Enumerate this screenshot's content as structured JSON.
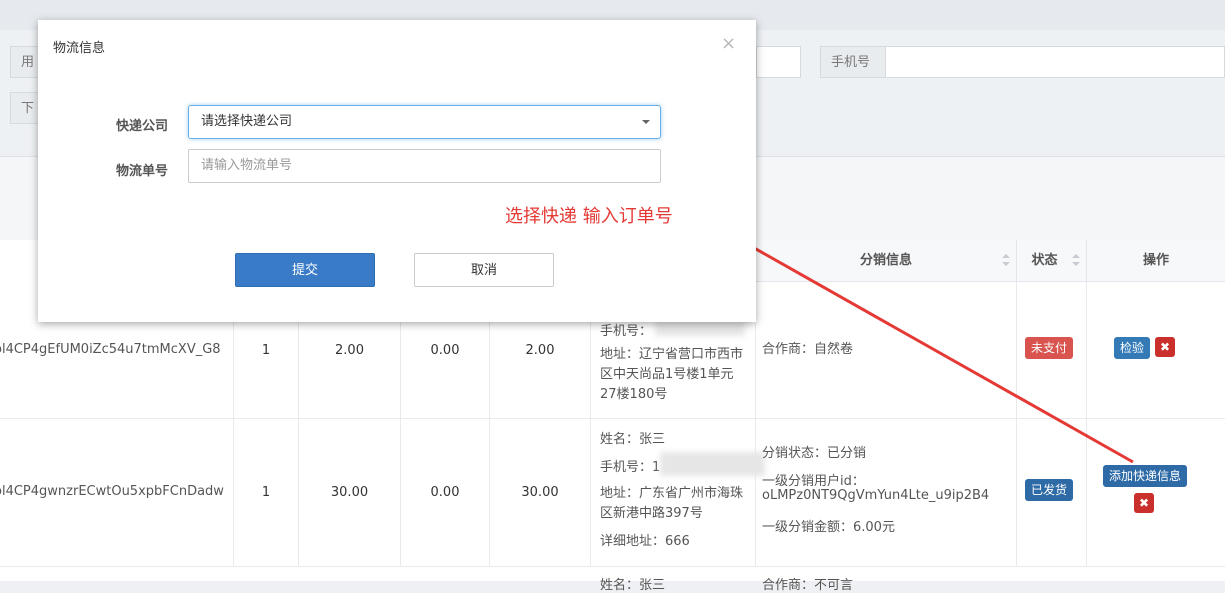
{
  "filters": {
    "label1": "用",
    "label2": "下",
    "phone_label": "手机号"
  },
  "table": {
    "headers": [
      "分销信息",
      "状态",
      "操作"
    ],
    "rows": [
      {
        "order_id": "ol4CP4gEfUM0iZc54u7tmMcXV_G8",
        "qty": "1",
        "price": "2.00",
        "discount": "0.00",
        "total": "2.00",
        "phone_label": "手机号：",
        "address": "地址：辽宁省营口市西市区中天尚品1号楼1单元27楼180号",
        "distribution": "合作商：自然卷",
        "status": "未支付",
        "actions": [
          "检验"
        ]
      },
      {
        "order_id": "ol4CP4gwnzrECwtOu5xpbFCnDadw",
        "qty": "1",
        "price": "30.00",
        "discount": "0.00",
        "total": "30.00",
        "name": "姓名：张三",
        "phone_label": "手机号：1",
        "address": "地址：广东省广州市海珠区新港中路397号",
        "detail": "详细地址：666",
        "dist_status": "分销状态：已分销",
        "dist_user_label": "一级分销用户id：",
        "dist_user_id": "oLMPz0NT9QgVmYun4Lte_u9ip2B4",
        "dist_amount": "一级分销金额：6.00元",
        "status": "已发货",
        "actions": [
          "添加快递信息"
        ]
      },
      {
        "name_partial": "姓名：张三",
        "distribution_partial": "合作商：不可言"
      }
    ]
  },
  "modal": {
    "title": "物流信息",
    "close": "×",
    "courier_label": "快递公司",
    "courier_value": "请选择快递公司",
    "tracking_label": "物流单号",
    "tracking_placeholder": "请输入物流单号",
    "annotation": "选择快递 输入订单号",
    "submit": "提交",
    "cancel": "取消"
  },
  "colors": {
    "primary": "#3a7bc8",
    "danger": "#d9534f",
    "annotation": "#e53935"
  }
}
